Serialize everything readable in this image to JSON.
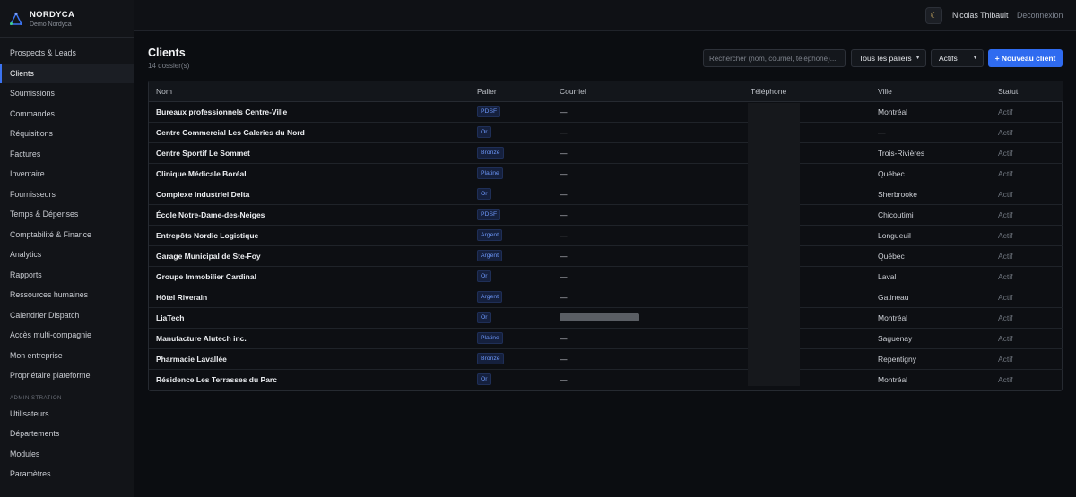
{
  "brand": {
    "name": "NORDYCA",
    "subtitle": "Demo Nordyca"
  },
  "sidebar": {
    "items": [
      "Prospects & Leads",
      "Clients",
      "Soumissions",
      "Commandes",
      "Réquisitions",
      "Factures",
      "Inventaire",
      "Fournisseurs",
      "Temps & Dépenses",
      "Comptabilité & Finance",
      "Analytics",
      "Rapports",
      "Ressources humaines",
      "Calendrier Dispatch",
      "Accès multi-compagnie",
      "Mon entreprise",
      "Propriétaire plateforme"
    ],
    "active": "Clients",
    "admin_label": "ADMINISTRATION",
    "admin_items": [
      "Utilisateurs",
      "Départements",
      "Modules",
      "Paramètres"
    ]
  },
  "topbar": {
    "theme_icon": "moon-icon",
    "user_name": "Nicolas Thibault",
    "logout": "Deconnexion"
  },
  "page": {
    "title": "Clients",
    "count": "14 dossier(s)",
    "search_placeholder": "Rechercher (nom, courriel, téléphone)...",
    "tier_filter": "Tous les paliers",
    "status_filter": "Actifs",
    "new_button": "+ Nouveau client"
  },
  "table": {
    "headers": {
      "name": "Nom",
      "tier": "Palier",
      "email": "Courriel",
      "phone": "Téléphone",
      "city": "Ville",
      "status": "Statut"
    },
    "rows": [
      {
        "name": "Bureaux professionnels Centre-Ville",
        "tier": "PDSF",
        "email": "—",
        "city": "Montréal",
        "status": "Actif"
      },
      {
        "name": "Centre Commercial Les Galeries du Nord",
        "tier": "Or",
        "email": "—",
        "city": "—",
        "status": "Actif"
      },
      {
        "name": "Centre Sportif Le Sommet",
        "tier": "Bronze",
        "email": "—",
        "city": "Trois-Rivières",
        "status": "Actif"
      },
      {
        "name": "Clinique Médicale Boréal",
        "tier": "Platine",
        "email": "—",
        "city": "Québec",
        "status": "Actif"
      },
      {
        "name": "Complexe industriel Delta",
        "tier": "Or",
        "email": "—",
        "city": "Sherbrooke",
        "status": "Actif"
      },
      {
        "name": "École Notre-Dame-des-Neiges",
        "tier": "PDSF",
        "email": "—",
        "city": "Chicoutimi",
        "status": "Actif"
      },
      {
        "name": "Entrepôts Nordic Logistique",
        "tier": "Argent",
        "email": "—",
        "city": "Longueuil",
        "status": "Actif"
      },
      {
        "name": "Garage Municipal de Ste-Foy",
        "tier": "Argent",
        "email": "—",
        "city": "Québec",
        "status": "Actif"
      },
      {
        "name": "Groupe Immobilier Cardinal",
        "tier": "Or",
        "email": "—",
        "city": "Laval",
        "status": "Actif"
      },
      {
        "name": "Hôtel Riverain",
        "tier": "Argent",
        "email": "—",
        "city": "Gatineau",
        "status": "Actif"
      },
      {
        "name": "LiaTech",
        "tier": "Or",
        "email": "",
        "city": "Montréal",
        "status": "Actif"
      },
      {
        "name": "Manufacture Alutech inc.",
        "tier": "Platine",
        "email": "—",
        "city": "Saguenay",
        "status": "Actif"
      },
      {
        "name": "Pharmacie Lavallée",
        "tier": "Bronze",
        "email": "—",
        "city": "Repentigny",
        "status": "Actif"
      },
      {
        "name": "Résidence Les Terrasses du Parc",
        "tier": "Or",
        "email": "—",
        "city": "Montréal",
        "status": "Actif"
      }
    ]
  },
  "colors": {
    "accent": "#2f6bf0",
    "badge_text": "#6b95f5",
    "background": "#0b0d11"
  }
}
